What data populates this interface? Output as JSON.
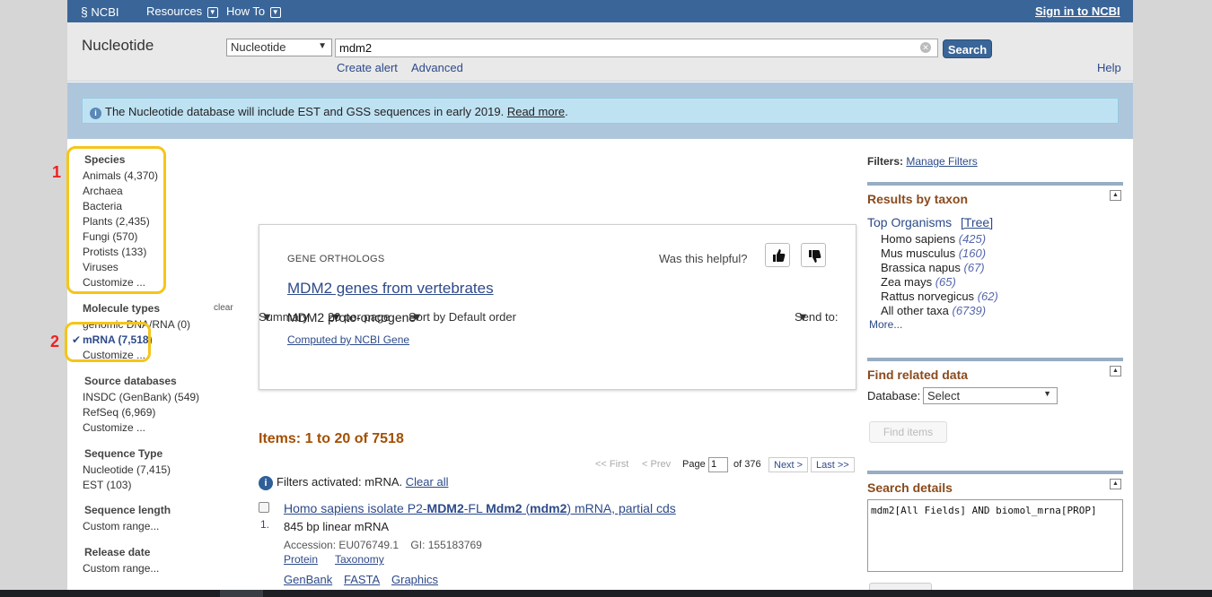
{
  "ncbi_bar": {
    "logo": "NCBI",
    "resources": "Resources",
    "how_to": "How To",
    "sign_in": "Sign in to NCBI"
  },
  "search": {
    "db_title": "Nucleotide",
    "db_selected": "Nucleotide",
    "query": "mdm2",
    "button": "Search",
    "create_alert": "Create alert",
    "advanced": "Advanced",
    "help": "Help"
  },
  "notice": {
    "text": "The Nucleotide database will include EST and GSS sequences in early 2019.",
    "link": "Read more",
    "tail": "."
  },
  "sidebar": {
    "species_head": "Species",
    "species": [
      "Animals (4,370)",
      "Archaea",
      "Bacteria",
      "Plants (2,435)",
      "Fungi (570)",
      "Protists (133)",
      "Viruses",
      "Customize ..."
    ],
    "mol_head": "Molecule types",
    "mol_clear": "clear",
    "mol": [
      "genomic DNA/RNA (0)",
      "mRNA (7,518)",
      "Customize ..."
    ],
    "src_head": "Source databases",
    "src": [
      "INSDC (GenBank) (549)",
      "RefSeq (6,969)",
      "Customize ..."
    ],
    "seqtype_head": "Sequence Type",
    "seqtype": [
      "Nucleotide (7,415)",
      "EST (103)"
    ],
    "seqlen_head": "Sequence length",
    "seqlen": "Custom range...",
    "release_head": "Release date",
    "release": "Custom range..."
  },
  "toolbar": {
    "summary": "Summary",
    "per_page": "20 per page",
    "sort": "Sort by Default order",
    "send_to": "Send to:"
  },
  "ortho": {
    "label": "GENE ORTHOLOGS",
    "helpful": "Was this helpful?",
    "title": "MDM2 genes from vertebrates",
    "desc": "MDM2 proto-oncogene",
    "computed": "Computed by NCBI Gene"
  },
  "results": {
    "count": "Items: 1 to 20 of 7518",
    "pager": {
      "first": "<< First",
      "prev": "< Prev",
      "page_label": "Page",
      "page": "1",
      "of": "of 376",
      "next": "Next >",
      "last": "Last >>"
    },
    "filters_text": "Filters activated: mRNA.",
    "clear_all": "Clear all",
    "item1": {
      "num": "1.",
      "title_pre": "Homo sapiens isolate P2-",
      "b1": "MDM2",
      "mid1": "-FL ",
      "b2": "Mdm2",
      "mid2": " (",
      "b3": "mdm2",
      "tail": ") mRNA, partial cds",
      "desc": "845 bp linear mRNA",
      "accession": "Accession: EU076749.1    GI: 155183769",
      "links1": [
        "Protein",
        "Taxonomy"
      ],
      "links2": [
        "GenBank",
        "FASTA",
        "Graphics"
      ]
    }
  },
  "right": {
    "filters_label": "Filters:",
    "manage": "Manage Filters",
    "taxon_head": "Results by taxon",
    "top_org": "Top Organisms",
    "tree": "[Tree]",
    "taxa": [
      {
        "name": "Homo sapiens",
        "count": "(425)"
      },
      {
        "name": "Mus musculus",
        "count": "(160)"
      },
      {
        "name": "Brassica napus",
        "count": "(67)"
      },
      {
        "name": "Zea mays",
        "count": "(65)"
      },
      {
        "name": "Rattus norvegicus",
        "count": "(62)"
      },
      {
        "name": "All other taxa",
        "count": "(6739)"
      }
    ],
    "more": "More...",
    "related_head": "Find related data",
    "database_label": "Database:",
    "database_value": "Select",
    "find_items": "Find items",
    "details_head": "Search details",
    "details_query": "mdm2[All Fields] AND biomol_mrna[PROP]"
  },
  "annotations": {
    "one": "1",
    "two": "2"
  },
  "colors": {
    "header_blue": "#3a6598",
    "notice_bg": "#bfe2f3",
    "section_head": "#8a4a1c",
    "items_count": "#a34f00",
    "annotation": "#f5c518",
    "annotation_num": "#e22222"
  }
}
